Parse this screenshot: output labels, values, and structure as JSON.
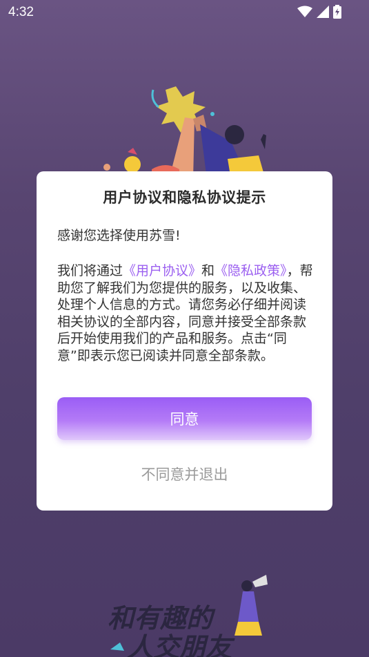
{
  "status_bar": {
    "time": "4:32",
    "icons": [
      "wifi-icon",
      "signal-icon",
      "battery-charging-icon"
    ]
  },
  "background": {
    "slogan_line1": "和有趣的",
    "slogan_line2": "人交朋友"
  },
  "dialog": {
    "title": "用户协议和隐私协议提示",
    "greeting": "感谢您选择使用苏雪!",
    "body_prefix": "我们将通过",
    "link_user_agreement": "《用户协议》",
    "body_and": "和",
    "link_privacy_policy": "《隐私政策》",
    "body_suffix": "，帮助您了解我们为您提供的服务，以及收集、处理个人信息的方式。请您务必仔细并阅读相关协议的全部内容，同意并接受全部条款后开始使用我们的产品和服务。点击“同意”即表示您已阅读并同意全部条款。",
    "agree_label": "同意",
    "disagree_label": "不同意并退出"
  },
  "colors": {
    "accent": "#9b5ff0",
    "background_top": "#6a5483",
    "background_bottom": "#4b3a66"
  }
}
